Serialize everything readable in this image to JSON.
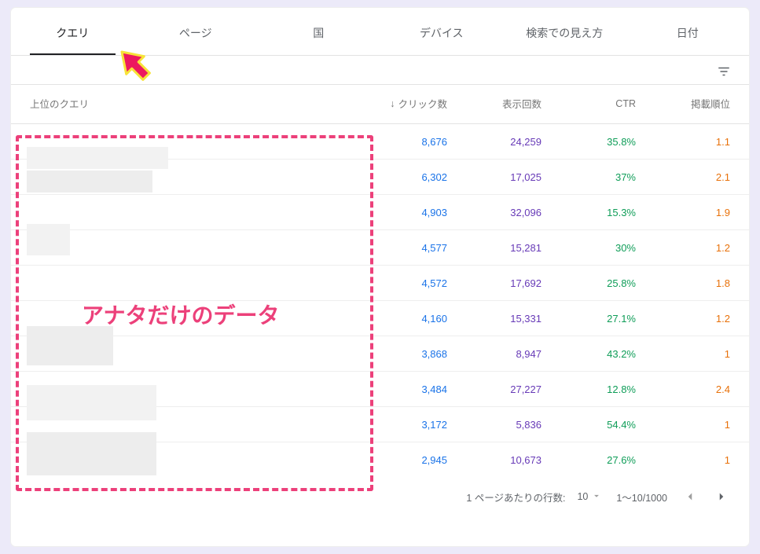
{
  "tabs": {
    "items": [
      {
        "label": "クエリ",
        "active": true
      },
      {
        "label": "ページ",
        "active": false
      },
      {
        "label": "国",
        "active": false
      },
      {
        "label": "デバイス",
        "active": false
      },
      {
        "label": "検索での見え方",
        "active": false
      },
      {
        "label": "日付",
        "active": false
      }
    ]
  },
  "columns": {
    "query": "上位のクエリ",
    "clicks": "クリック数",
    "impressions": "表示回数",
    "ctr": "CTR",
    "position": "掲載順位"
  },
  "sort_indicator": "↓",
  "rows": [
    {
      "clicks": "8,676",
      "impressions": "24,259",
      "ctr": "35.8%",
      "position": "1.1"
    },
    {
      "clicks": "6,302",
      "impressions": "17,025",
      "ctr": "37%",
      "position": "2.1"
    },
    {
      "clicks": "4,903",
      "impressions": "32,096",
      "ctr": "15.3%",
      "position": "1.9"
    },
    {
      "clicks": "4,577",
      "impressions": "15,281",
      "ctr": "30%",
      "position": "1.2"
    },
    {
      "clicks": "4,572",
      "impressions": "17,692",
      "ctr": "25.8%",
      "position": "1.8"
    },
    {
      "clicks": "4,160",
      "impressions": "15,331",
      "ctr": "27.1%",
      "position": "1.2"
    },
    {
      "clicks": "3,868",
      "impressions": "8,947",
      "ctr": "43.2%",
      "position": "1"
    },
    {
      "clicks": "3,484",
      "impressions": "27,227",
      "ctr": "12.8%",
      "position": "2.4"
    },
    {
      "clicks": "3,172",
      "impressions": "5,836",
      "ctr": "54.4%",
      "position": "1"
    },
    {
      "clicks": "2,945",
      "impressions": "10,673",
      "ctr": "27.6%",
      "position": "1"
    }
  ],
  "pagination": {
    "rows_per_page_label": "1 ページあたりの行数:",
    "rows_per_page_value": "10",
    "range": "1～10/1000"
  },
  "annotation": {
    "text": "アナタだけのデータ"
  },
  "colors": {
    "clicks": "#1a73e8",
    "impressions": "#673ab7",
    "ctr": "#0f9d58",
    "position": "#e8710a",
    "accent": "#ec407a"
  }
}
